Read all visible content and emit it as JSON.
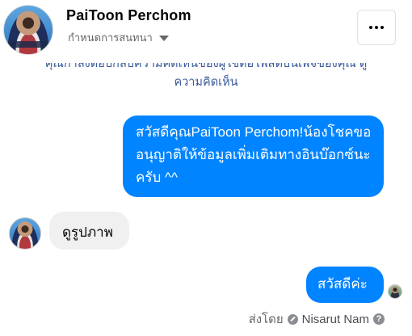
{
  "header": {
    "title": "PaiToon Perchom",
    "subtitle": "กำหนดการสนทนา",
    "more_icon": "more-dots-icon"
  },
  "notice": {
    "line1": "คุณกำลังตอบกลับความคิดเห็นของผู้ใช้ต่อโพสต์บนเพจของคุณ ดู",
    "line2": "ความคิดเห็น"
  },
  "messages": [
    {
      "direction": "outgoing",
      "text": "สวัสดีคุณPaiToon Perchom!น้องโชคขออนุญาติให้ข้อมูลเพิ่มเติมทางอินบ๊อกซ์นะครับ ^^"
    },
    {
      "direction": "incoming",
      "text": "ดูรูปภาพ"
    },
    {
      "direction": "outgoing",
      "text": "สวัสดีค่ะ"
    }
  ],
  "footer": {
    "sent_by_label": "ส่งโดย",
    "sender": "Nisarut Nam",
    "help_icon_glyph": "?"
  },
  "colors": {
    "outgoing_bubble": "#0084ff",
    "incoming_bubble": "#f0f0f0",
    "link": "#385898"
  }
}
